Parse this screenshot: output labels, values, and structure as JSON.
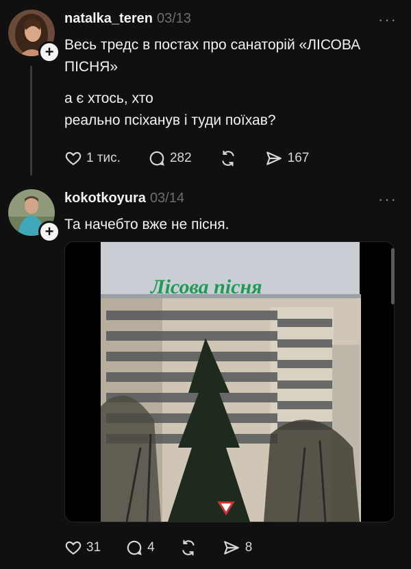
{
  "posts": [
    {
      "username": "natalka_teren",
      "date": "03/13",
      "more": "···",
      "text1": "Весь тредс в постах про санаторій «ЛІСОВА",
      "text2": "ПІСНЯ»",
      "text3": "а є хтось, хто",
      "text4": "реально псіханув і туди поїхав?",
      "likes": "1 тис.",
      "comments": "282",
      "shares": "167"
    },
    {
      "username": "kokotkoyura",
      "date": "03/14",
      "more": "···",
      "text1": "Та начебто вже не пісня.",
      "media_sign": "Лісова пісня",
      "likes": "31",
      "comments": "4",
      "shares": "8"
    }
  ],
  "colors": {
    "background": "#101010",
    "text": "#f3f3f3",
    "muted": "#6e6e6e",
    "sign_green": "#1f9a55"
  },
  "icons": [
    "plus-icon",
    "heart-icon",
    "comment-icon",
    "repost-icon",
    "share-icon",
    "more-icon"
  ]
}
